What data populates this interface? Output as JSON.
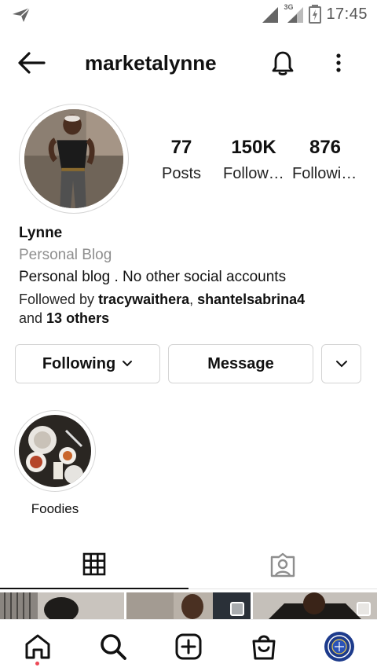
{
  "status_bar": {
    "time": "17:45",
    "network": "3G"
  },
  "header": {
    "username": "marketalynne"
  },
  "stats": {
    "posts_count": "77",
    "posts_label": "Posts",
    "followers_count": "150K",
    "followers_label": "Followers",
    "following_count": "876",
    "following_label": "Following"
  },
  "bio": {
    "name": "Lynne",
    "category": "Personal Blog",
    "description": "Personal blog . No other social accounts",
    "followed_by_prefix": "Followed by ",
    "follower_one": "tracywaithera",
    "separator": ", ",
    "follower_two": "shantelsabrina4",
    "and_text": "and ",
    "others_text": "13 others"
  },
  "actions": {
    "following_label": "Following",
    "message_label": "Message"
  },
  "highlights": [
    {
      "label": "Foodies"
    }
  ],
  "icons": {
    "send": "send-icon",
    "back": "back-arrow-icon",
    "bell": "bell-icon",
    "more": "more-vertical-icon",
    "grid": "grid-icon",
    "tagged": "tagged-icon",
    "home": "home-icon",
    "search": "search-icon",
    "create": "create-icon",
    "shop": "shop-icon",
    "profile": "profile-avatar-icon"
  },
  "colors": {
    "notification_dot": "#ed4956",
    "secondary_text": "#8e8e8e",
    "border": "#d4d4d4"
  }
}
